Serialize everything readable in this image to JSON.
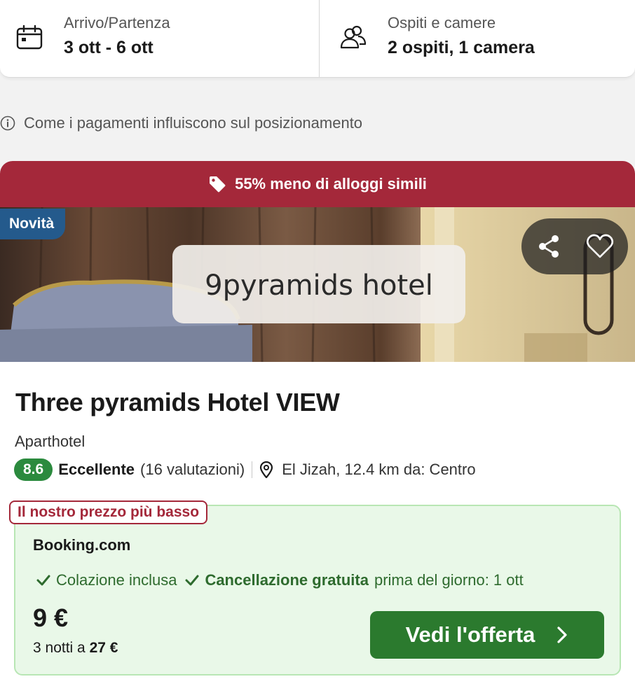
{
  "search_bar": {
    "dates": {
      "label": "Arrivo/Partenza",
      "value": "3 ott - 6 ott",
      "icon": "calendar-icon"
    },
    "guests": {
      "label": "Ospiti e camere",
      "value": "2 ospiti, 1 camera",
      "icon": "guests-icon"
    }
  },
  "info_line": {
    "text": "Come i pagamenti influiscono sul posizionamento",
    "icon": "info-icon"
  },
  "card": {
    "deal_banner": "55% meno di alloggi simili",
    "badge_new": "Novità",
    "photo_caption": "9pyramids hotel",
    "hotel_name": "Three pyramids Hotel VIEW",
    "property_type": "Aparthotel",
    "rating": {
      "score": "8.6",
      "label": "Eccellente",
      "count": "(16 valutazioni)"
    },
    "location": "El Jizah, 12.4 km da: Centro",
    "offer": {
      "tag": "Il nostro prezzo più basso",
      "provider": "Booking.com",
      "feature_1": "Colazione inclusa",
      "feature_2": "Cancellazione gratuita",
      "feature_2_detail": "prima del giorno: 1 ott",
      "price": "9 €",
      "total_prefix": "3 notti a",
      "total_value": "27 €",
      "cta_label": "Vedi l'offerta"
    }
  },
  "colors": {
    "banner_red": "#a4283a",
    "badge_blue": "#245a8c",
    "score_green": "#2b8a3e",
    "cta_green": "#2b7a2e",
    "offer_bg": "#e9f8e8"
  }
}
